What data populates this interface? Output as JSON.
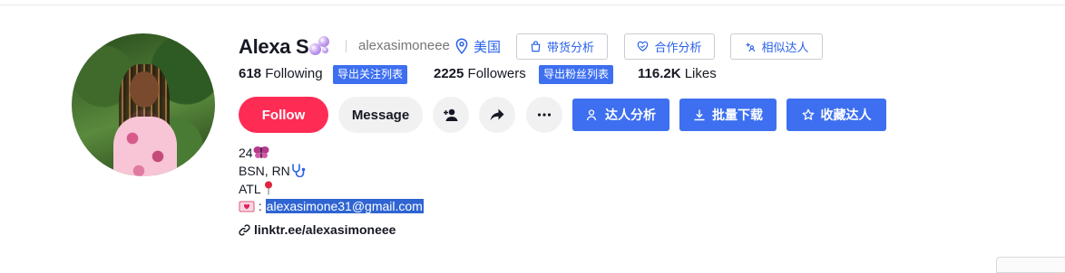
{
  "profile": {
    "display_name": "Alexa S",
    "handle": "alexasimoneee",
    "location": "美国"
  },
  "header_buttons": {
    "sales": "带货分析",
    "coop": "合作分析",
    "similar": "相似达人"
  },
  "stats": {
    "following_count": "618",
    "following_label": "Following",
    "export_following": "导出关注列表",
    "followers_count": "2225",
    "followers_label": "Followers",
    "export_followers": "导出粉丝列表",
    "likes_count": "116.2K",
    "likes_label": "Likes"
  },
  "actions": {
    "follow": "Follow",
    "message": "Message",
    "analysis": "达人分析",
    "download": "批量下载",
    "favorite": "收藏达人"
  },
  "bio": {
    "line1": "24",
    "line2": "BSN, RN",
    "line3": "ATL",
    "email_prefix": ":",
    "email": "alexasimone31@gmail.com",
    "link": "linktr.ee/alexasimoneee"
  },
  "colors": {
    "accent_blue": "#3d6ff0",
    "follow_red": "#fe2c55",
    "selection_blue": "#2f64d2"
  }
}
